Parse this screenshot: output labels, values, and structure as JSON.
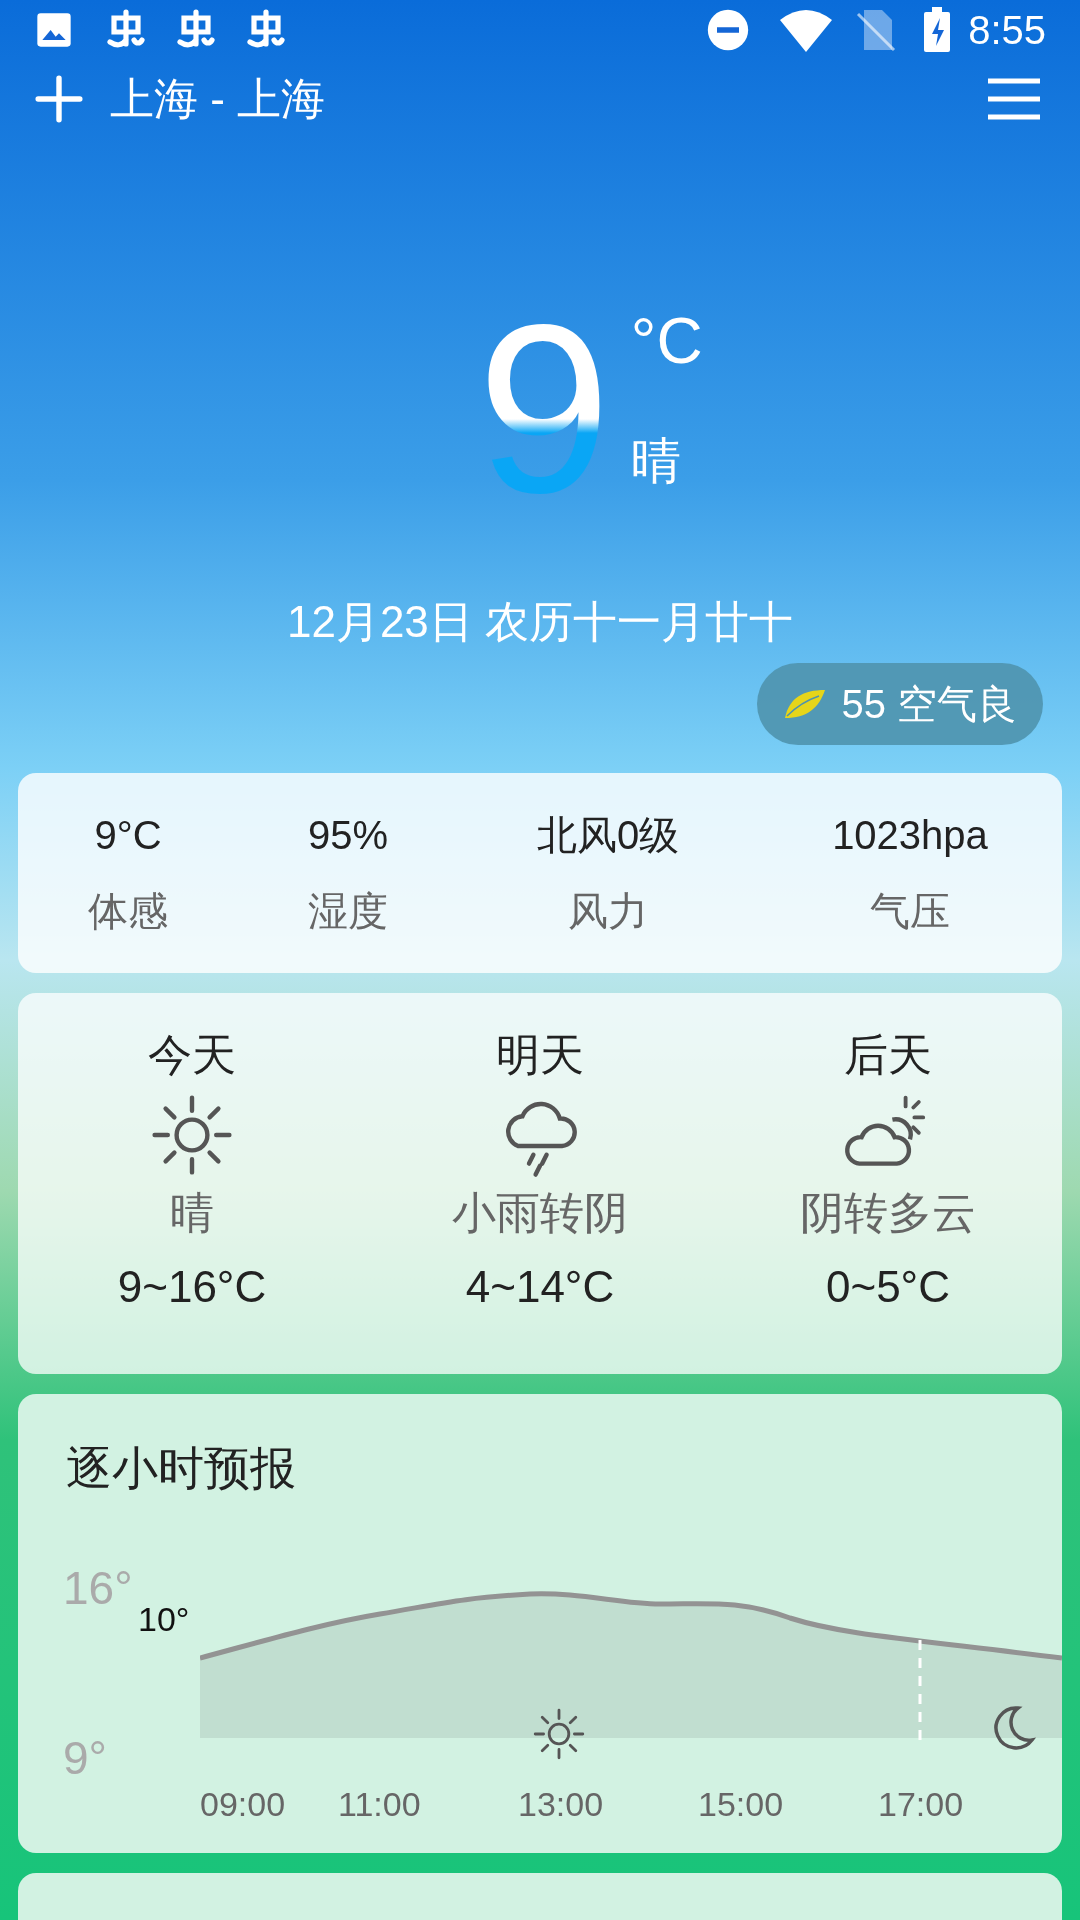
{
  "status_bar": {
    "time": "8:55"
  },
  "header": {
    "city": "上海 - 上海"
  },
  "current": {
    "temperature": "9",
    "unit": "°C",
    "condition": "晴",
    "date": "12月23日 农历十一月廿十",
    "aqi": "55 空气良"
  },
  "details": [
    {
      "value": "9°C",
      "label": "体感"
    },
    {
      "value": "95%",
      "label": "湿度"
    },
    {
      "value": "北风0级",
      "label": "风力"
    },
    {
      "value": "1023hpa",
      "label": "气压"
    }
  ],
  "forecast": [
    {
      "day": "今天",
      "kind": "sunny",
      "condition": "晴",
      "range": "9~16°C"
    },
    {
      "day": "明天",
      "kind": "rain",
      "condition": "小雨转阴",
      "range": "4~14°C"
    },
    {
      "day": "后天",
      "kind": "partly_cloudy",
      "condition": "阴转多云",
      "range": "0~5°C"
    }
  ],
  "hourly": {
    "title": "逐小时预报",
    "y_top": "16°",
    "y_bottom": "9°",
    "start_label": "10°",
    "times": [
      "09:00",
      "11:00",
      "13:00",
      "15:00",
      "17:00"
    ]
  }
}
